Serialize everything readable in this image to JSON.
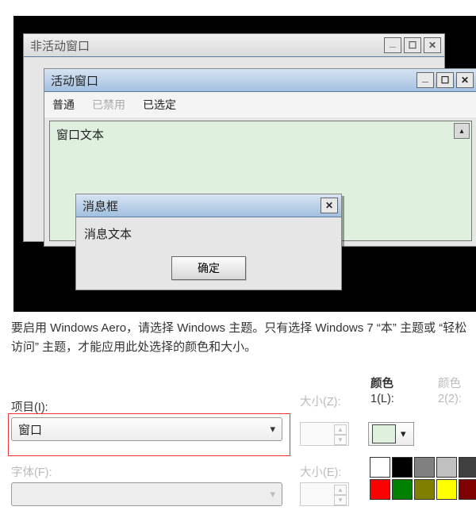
{
  "preview": {
    "inactive_window": {
      "title": "非活动窗口"
    },
    "active_window": {
      "title": "活动窗口",
      "menu": {
        "normal": "普通",
        "disabled": "已禁用",
        "selected": "已选定"
      },
      "document_text": "窗口文本"
    },
    "messagebox": {
      "title": "消息框",
      "body": "消息文本",
      "ok": "确定"
    }
  },
  "description": "要启用 Windows Aero，请选择 Windows 主题。只有选择 Windows 7 “本” 主题或 “轻松访问” 主题，才能应用此处选择的颜色和大小。",
  "form": {
    "item_label": "项目(I):",
    "item_value": "窗口",
    "size_z_label": "大小(Z):",
    "color_header": "颜色",
    "color1_label": "1(L):",
    "color2_header": "颜色",
    "color2_label": "2(2):",
    "font_label": "字体(F):",
    "size_e_label": "大小(E):",
    "color1_value": "#dff0de"
  },
  "palette_colors": [
    "#ffffff",
    "#000000",
    "#808080",
    "#c0c0c0",
    "#404040",
    "#ff0000",
    "#008000",
    "#808000",
    "#ffff00",
    "#800000"
  ]
}
